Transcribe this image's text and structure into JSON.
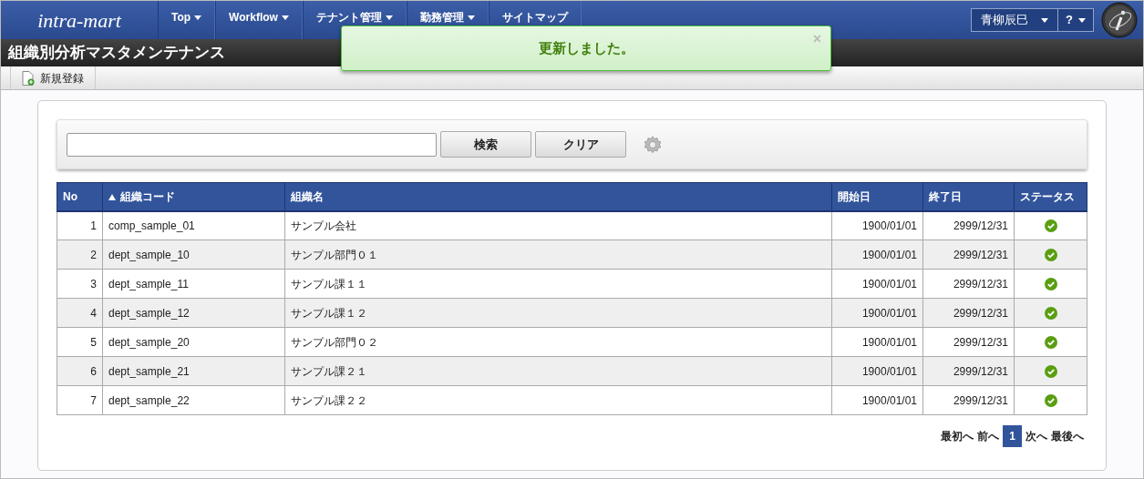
{
  "header": {
    "logo": "intra-mart",
    "nav": [
      {
        "label": "Top",
        "dropdown": true
      },
      {
        "label": "Workflow",
        "dropdown": true
      },
      {
        "label": "テナント管理",
        "dropdown": true
      },
      {
        "label": "勤務管理",
        "dropdown": true
      },
      {
        "label": "サイトマップ",
        "dropdown": false
      }
    ],
    "user": "青柳辰巳",
    "help": "?"
  },
  "notification": {
    "message": "更新しました。",
    "close": "×"
  },
  "page_title": "組織別分析マスタメンテナンス",
  "toolbar": [
    {
      "label": "新規登録"
    }
  ],
  "search": {
    "buttons": [
      "検索",
      "クリア"
    ]
  },
  "table": {
    "columns": [
      {
        "label": "No",
        "sorted_ascending": false
      },
      {
        "label": "組織コード",
        "sorted_ascending": true
      },
      {
        "label": "組織名",
        "sorted_ascending": false
      },
      {
        "label": "開始日",
        "sorted_ascending": false
      },
      {
        "label": "終了日",
        "sorted_ascending": false
      },
      {
        "label": "ステータス",
        "sorted_ascending": false
      }
    ],
    "rows": [
      {
        "no": "1",
        "code": "comp_sample_01",
        "name": "サンプル会社",
        "start": "1900/01/01",
        "end": "2999/12/31",
        "active": true
      },
      {
        "no": "2",
        "code": "dept_sample_10",
        "name": "サンプル部門０１",
        "start": "1900/01/01",
        "end": "2999/12/31",
        "active": true
      },
      {
        "no": "3",
        "code": "dept_sample_11",
        "name": "サンプル課１１",
        "start": "1900/01/01",
        "end": "2999/12/31",
        "active": true
      },
      {
        "no": "4",
        "code": "dept_sample_12",
        "name": "サンプル課１２",
        "start": "1900/01/01",
        "end": "2999/12/31",
        "active": true
      },
      {
        "no": "5",
        "code": "dept_sample_20",
        "name": "サンプル部門０２",
        "start": "1900/01/01",
        "end": "2999/12/31",
        "active": true
      },
      {
        "no": "6",
        "code": "dept_sample_21",
        "name": "サンプル課２１",
        "start": "1900/01/01",
        "end": "2999/12/31",
        "active": true
      },
      {
        "no": "7",
        "code": "dept_sample_22",
        "name": "サンプル課２２",
        "start": "1900/01/01",
        "end": "2999/12/31",
        "active": true
      }
    ]
  },
  "pager": {
    "first": "最初へ",
    "prev": "前へ",
    "pages": [
      {
        "label": "1",
        "selected": true
      }
    ],
    "next": "次へ",
    "last": "最後へ"
  }
}
